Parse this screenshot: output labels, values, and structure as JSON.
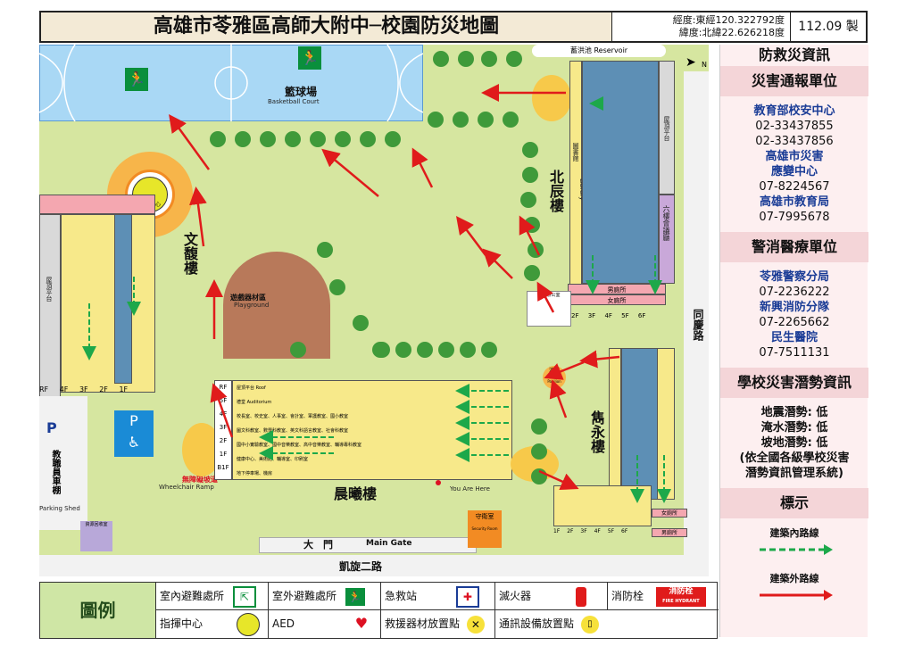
{
  "header": {
    "title": "高雄市苓雅區高師大附中─校園防災地圖",
    "longitude": "經度:東經120.322792度",
    "latitude": "緯度:北緯22.626218度",
    "version": "112.09 製"
  },
  "map": {
    "basketball": "籃球場",
    "basketball_en": "Basketball Court",
    "reservoir": "蓄洪池 Reservoir",
    "command_center": "指揮中心",
    "wenfu": "文馥樓",
    "beichen": "北辰樓",
    "juanyong": "雋永樓",
    "chenxi": "晨曦樓",
    "playground": "遊戲器材區",
    "playground_en": "Playground",
    "wheelchair": "無障礙坡道",
    "wheelchair_en": "Wheelchair Ramp",
    "parking": "教職員車棚",
    "parking_en": "Parking Shed",
    "main_gate": "大　門",
    "main_gate_en": "Main Gate",
    "security": "守衛室",
    "security_en": "Security Room",
    "recycling": "資源回收室",
    "kaixuan_road": "凱旋二路",
    "tongqing_road": "同慶路",
    "library": "圖書館",
    "library_en": "Library",
    "roof": "屋頂平台",
    "roof_en": "Roof",
    "auditorium": "六樓會議廳",
    "you_are_here": "You Are Here",
    "pavilion": "涼亭",
    "pavilion_en": "Pavilion",
    "teacher_office": "教師辦公室",
    "mens_toilet": "男廁所",
    "womens_toilet": "女廁所",
    "north": "N",
    "floors_wenfu": [
      "RF",
      "4F",
      "3F",
      "2F",
      "1F"
    ],
    "floors_chenxi": [
      "RF",
      "5F",
      "4F",
      "3F",
      "2F",
      "1F",
      "B1F"
    ],
    "floors_beichen": [
      "2F",
      "3F",
      "4F",
      "5F",
      "6F"
    ],
    "floors_juanyong": [
      "1F",
      "2F",
      "3F",
      "4F",
      "5F",
      "6F"
    ],
    "chenxi_rows": [
      "屋頂平台 Roof",
      "禮堂 Auditorium",
      "校長室、校史室、人事室、會計室、軍護教室、國小教室",
      "圖文科教室、數學科教室、英文科語言教室、社會科教室",
      "國中小實驗教室、國中音樂教室、高中音樂教室、輔導專科教室",
      "健康中心、美術館、輔導室、印刷室",
      "地下停車場、機房"
    ]
  },
  "panel": {
    "title": "防救災資訊",
    "report_header": "災害通報單位",
    "report_lines": [
      {
        "text": "教育部校安中心",
        "style": "blue"
      },
      {
        "text": "02-33437855",
        "style": "plain"
      },
      {
        "text": "02-33437856",
        "style": "plain"
      },
      {
        "text": "高雄市災害",
        "style": "blue"
      },
      {
        "text": "應變中心",
        "style": "blue"
      },
      {
        "text": "07-8224567",
        "style": "plain"
      },
      {
        "text": "高雄市教育局",
        "style": "blue"
      },
      {
        "text": "07-7995678",
        "style": "plain"
      }
    ],
    "police_header": "警消醫療單位",
    "police_lines": [
      {
        "text": "苓雅警察分局",
        "style": "blue"
      },
      {
        "text": "07-2236222",
        "style": "plain"
      },
      {
        "text": "新興消防分隊",
        "style": "blue"
      },
      {
        "text": "07-2265662",
        "style": "plain"
      },
      {
        "text": "民生醫院",
        "style": "blue"
      },
      {
        "text": "07-7511131",
        "style": "plain"
      }
    ],
    "hazard_header": "學校災害潛勢資訊",
    "hazard_lines": [
      "地震潛勢: 低",
      "淹水潛勢: 低",
      "坡地潛勢: 低",
      "(依全國各級學校災害",
      "潛勢資訊管理系統)"
    ],
    "signs_header": "標示",
    "indoor_route": "建築內路線",
    "outdoor_route": "建築外路線"
  },
  "legend": {
    "title": "圖例",
    "items": [
      {
        "label": "室內避難處所",
        "icon": "indoor-shelter-icon"
      },
      {
        "label": "室外避難處所",
        "icon": "outdoor-shelter-icon"
      },
      {
        "label": "急救站",
        "icon": "first-aid-icon"
      },
      {
        "label": "滅火器",
        "icon": "fire-extinguisher-icon"
      },
      {
        "label": "消防栓",
        "icon": "fire-hydrant-icon"
      },
      {
        "label": "指揮中心",
        "icon": "command-center-icon"
      },
      {
        "label": "AED",
        "icon": "aed-icon"
      },
      {
        "label": "救援器材放置點",
        "icon": "rescue-tools-icon"
      },
      {
        "label": "通訊設備放置點",
        "icon": "comm-device-icon"
      }
    ],
    "hydrant_text": "消防栓",
    "hydrant_en": "FIRE HYDRANT",
    "aed_text": "AED"
  },
  "colors": {
    "grass": "#d6e6a0",
    "court": "#a9d8f5",
    "building_yellow": "#f7e98a",
    "building_blue": "#5d8fb5",
    "toilet_pink": "#f4a7b0",
    "route_red": "#e01b1b",
    "route_green": "#1da84a",
    "panel_header": "#f4d5d8"
  }
}
